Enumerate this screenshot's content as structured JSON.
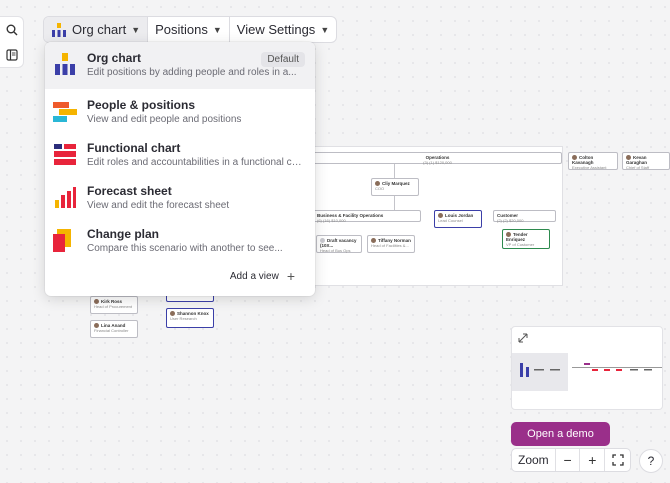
{
  "viewbar": {
    "tabs": [
      {
        "label": "Org chart",
        "active": true
      },
      {
        "label": "Positions",
        "active": false
      },
      {
        "label": "View Settings",
        "active": false
      }
    ]
  },
  "menu": {
    "items": [
      {
        "title": "Org chart",
        "desc": "Edit positions by adding people and roles in a...",
        "badge": "Default",
        "icon": "org-chart-icon"
      },
      {
        "title": "People & positions",
        "desc": "View and edit people and positions",
        "icon": "people-positions-icon"
      },
      {
        "title": "Functional chart",
        "desc": "Edit roles and accountabilities in a functional chart",
        "icon": "functional-chart-icon"
      },
      {
        "title": "Forecast sheet",
        "desc": "View and edit the forecast sheet",
        "icon": "forecast-sheet-icon"
      },
      {
        "title": "Change plan",
        "desc": "Compare this scenario with another to see...",
        "icon": "change-plan-icon"
      }
    ],
    "add_view": "Add a view"
  },
  "chart": {
    "operations": "Operations",
    "ops_stats": "(3)  (1) $120,000",
    "cliy": {
      "name": "Cliy Marquez",
      "role": "COO"
    },
    "facility": "Business & Facility Operations",
    "facility_stats": "(6)  (16) $10,000",
    "louis": {
      "name": "Louis Jordan",
      "role": "Lead Counsel"
    },
    "customer": "Customer",
    "customer_stats": "(2)  (2) $20,000",
    "draft": {
      "name": "Draft vacancy (10X...",
      "role": "Head of Bus Ops"
    },
    "tiffany": {
      "name": "Tiffany Norman",
      "role": "Head of Facilities &..."
    },
    "tender": {
      "name": "Tender Enriquez",
      "role": "VP of Customer"
    },
    "colton": {
      "name": "Colton Kavanagh",
      "role": "Executive Assistant"
    },
    "kevan": {
      "name": "Kevan Garaghan",
      "role": "Chief of Staff"
    },
    "kirk": {
      "name": "Kirk Ross",
      "role": "Head of Procurement"
    },
    "lina": {
      "name": "Lina Anand",
      "role": "Financial Controller"
    },
    "shannon": {
      "name": "Shannon Knox",
      "role": "User Research"
    }
  },
  "controls": {
    "demo": "Open a demo",
    "zoom": "Zoom",
    "zoom_out": "−",
    "zoom_in": "+",
    "help": "?"
  },
  "colors": {
    "accent": "#9a2f8a",
    "node_blue": "#3b3fa8",
    "node_green": "#2d8a4e"
  }
}
